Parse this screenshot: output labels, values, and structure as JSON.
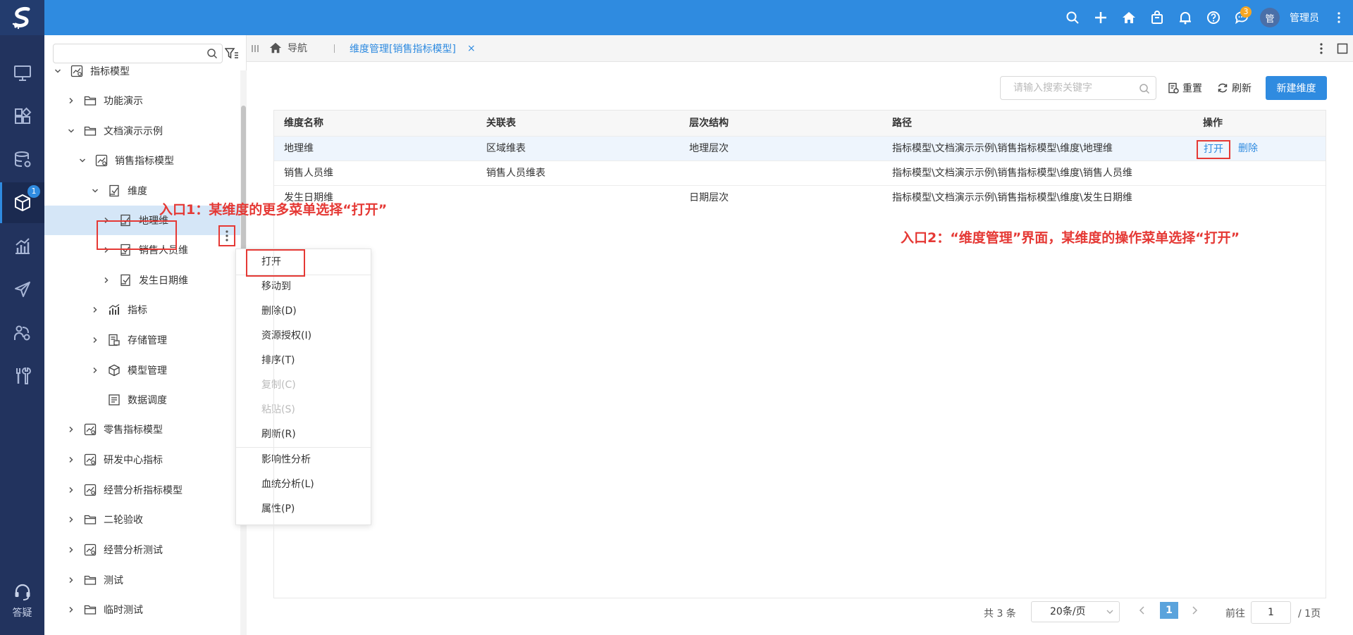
{
  "app": {
    "logo_icon": "s-logo-icon",
    "accent": "#2f8be0",
    "nav_bg": "#22335e"
  },
  "topbar": {
    "icons": [
      "search-icon",
      "plus-icon",
      "home-icon",
      "bag-icon",
      "bell-icon",
      "help-icon",
      "chat-icon"
    ],
    "chat_badge": "3",
    "avatar_text": "管",
    "user_name": "管理员"
  },
  "leftnav": {
    "items": [
      "monitor-icon",
      "widgets-icon",
      "database-icon",
      "cube-icon",
      "chart-icon",
      "send-icon",
      "share-icon",
      "tools-icon"
    ],
    "active_badge": "1",
    "qa_label": "答疑"
  },
  "tree": {
    "search_placeholder": "",
    "nodes": [
      {
        "label": "指标模型"
      },
      {
        "label": "功能演示"
      },
      {
        "label": "文档演示示例"
      },
      {
        "label": "销售指标模型"
      },
      {
        "label": "维度"
      },
      {
        "label": "地理维"
      },
      {
        "label": "销售人员维"
      },
      {
        "label": "发生日期维"
      },
      {
        "label": "指标"
      },
      {
        "label": "存储管理"
      },
      {
        "label": "模型管理"
      },
      {
        "label": "数据调度"
      },
      {
        "label": "零售指标模型"
      },
      {
        "label": "研发中心指标"
      },
      {
        "label": "经营分析指标模型"
      },
      {
        "label": "二轮验收"
      },
      {
        "label": "经营分析测试"
      },
      {
        "label": "测试"
      },
      {
        "label": "临时测试"
      }
    ]
  },
  "context_menu": {
    "items": [
      {
        "label": "打开"
      },
      {
        "label": "移动到"
      },
      {
        "label": "删除(D)"
      },
      {
        "label": "资源授权(I)"
      },
      {
        "label": "排序(T)"
      },
      {
        "label": "复制(C)"
      },
      {
        "label": "粘贴(S)"
      },
      {
        "label": "刷新(R)"
      },
      {
        "label": "影响性分析"
      },
      {
        "label": "血统分析(L)"
      },
      {
        "label": "属性(P)"
      }
    ]
  },
  "tabbar": {
    "home_label": "导航",
    "tab_label": "维度管理[销售指标模型]",
    "close": "×"
  },
  "toolbar": {
    "search_placeholder": "请输入搜索关键字",
    "reset_label": "重置",
    "refresh_label": "刷新",
    "new_label": "新建维度"
  },
  "table": {
    "headers": [
      "维度名称",
      "关联表",
      "层次结构",
      "路径",
      "操作"
    ],
    "rows": [
      {
        "name": "地理维",
        "table": "区域维表",
        "hierarchy": "地理层次",
        "path": "指标模型\\文档演示示例\\销售指标模型\\维度\\地理维"
      },
      {
        "name": "销售人员维",
        "table": "销售人员维表",
        "hierarchy": "",
        "path": "指标模型\\文档演示示例\\销售指标模型\\维度\\销售人员维"
      },
      {
        "name": "发生日期维",
        "table": "",
        "hierarchy": "日期层次",
        "path": "指标模型\\文档演示示例\\销售指标模型\\维度\\发生日期维"
      }
    ],
    "open_label": "打开",
    "delete_label": "删除"
  },
  "pager": {
    "total": "共 3 条",
    "size": "20条/页",
    "current": "1",
    "goto_label": "前往",
    "goto_value": "1",
    "pages": "/ 1页"
  },
  "annotations": {
    "entry1": "入口1：某维度的更多菜单选择“打开”",
    "entry2": "入口2：“维度管理”界面，某维度的操作菜单选择“打开”",
    "color": "#e53935"
  }
}
